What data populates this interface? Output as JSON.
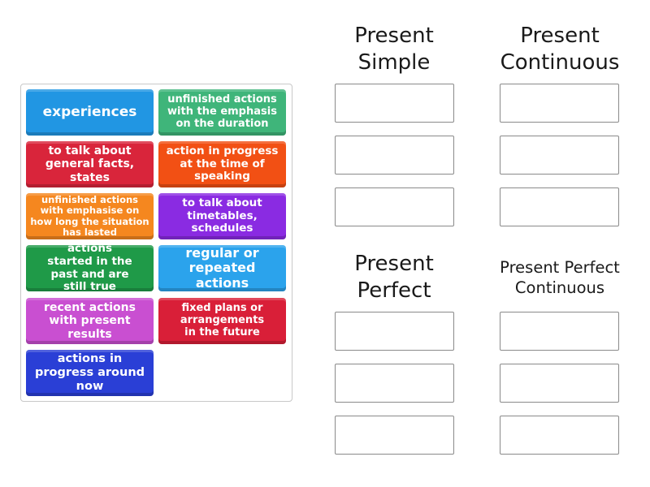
{
  "tiles": [
    {
      "label": "experiences",
      "color": "#2196e3"
    },
    {
      "label": "unfinished actions with the emphasis on the duration",
      "color": "#3fb57a"
    },
    {
      "label": "to talk about general facts, states",
      "color": "#d9253b"
    },
    {
      "label": "action in progress at the time of speaking",
      "color": "#f25014"
    },
    {
      "label": "unfinished actions with emphasise on how long the situation has lasted",
      "color": "#f5871f"
    },
    {
      "label": "to talk about timetables, schedules",
      "color": "#8a2be2"
    },
    {
      "label": "actions started in the past and are still true",
      "color": "#1f9a48"
    },
    {
      "label": "regular or repeated actions",
      "color": "#2ba3ec"
    },
    {
      "label": "recent actions with present results",
      "color": "#c94fd1"
    },
    {
      "label": "fixed plans or arrangements in the future",
      "color": "#d91f38"
    },
    {
      "label": "actions in progress around now",
      "color": "#2a3fd6"
    }
  ],
  "groups": [
    {
      "title": "Present Simple"
    },
    {
      "title": "Present Continuous"
    },
    {
      "title": "Present Perfect"
    },
    {
      "title": "Present Perfect Continuous"
    }
  ]
}
